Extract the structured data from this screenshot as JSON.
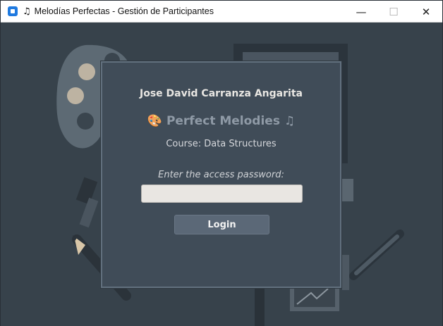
{
  "window": {
    "title": "Melodías Perfectas - Gestión de Participantes",
    "title_icon": "music-note-icon",
    "controls": {
      "minimize": "—",
      "maximize": "☐",
      "close": "✕"
    }
  },
  "login": {
    "student_name": "Jose David Carranza Angarita",
    "app_name": "Perfect Melodies",
    "heading_left_icon": "🎨",
    "heading_right_icon": "♫",
    "course": "Course: Data Structures",
    "password_label": "Enter the access password:",
    "password_value": "",
    "login_button": "Login"
  },
  "colors": {
    "background": "#37424b",
    "card": "#404c58",
    "button": "#5b6877",
    "input": "#e9e6e2"
  }
}
